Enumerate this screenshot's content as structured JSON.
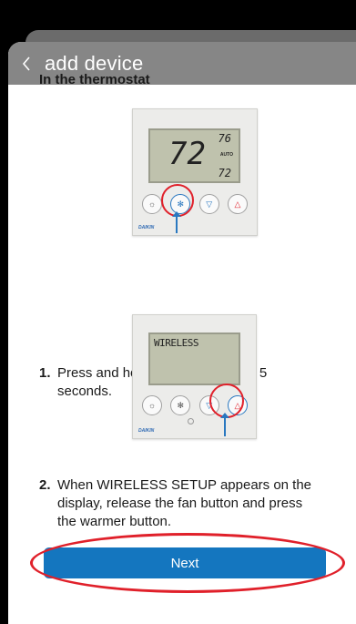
{
  "header": {
    "title": "add device",
    "back_icon": "chevron-left-icon"
  },
  "content": {
    "section_title": "In the thermostat",
    "steps": [
      {
        "number": "1.",
        "text": "Press and hold the fan button for 5 seconds."
      },
      {
        "number": "2.",
        "text": "When WIRELESS SETUP appears on the display, release the fan button and press the warmer button."
      }
    ]
  },
  "thermostat1": {
    "temp_main": "72",
    "temp_top": "76",
    "mode": "AUTO",
    "temp_bottom": "72",
    "brand": "DAIKIN"
  },
  "thermostat2": {
    "display_text": "WIRELESS",
    "brand": "DAIKIN"
  },
  "footer": {
    "next_label": "Next"
  },
  "colors": {
    "header_bg": "#868686",
    "accent": "#1476bf",
    "highlight": "#e0202a"
  }
}
